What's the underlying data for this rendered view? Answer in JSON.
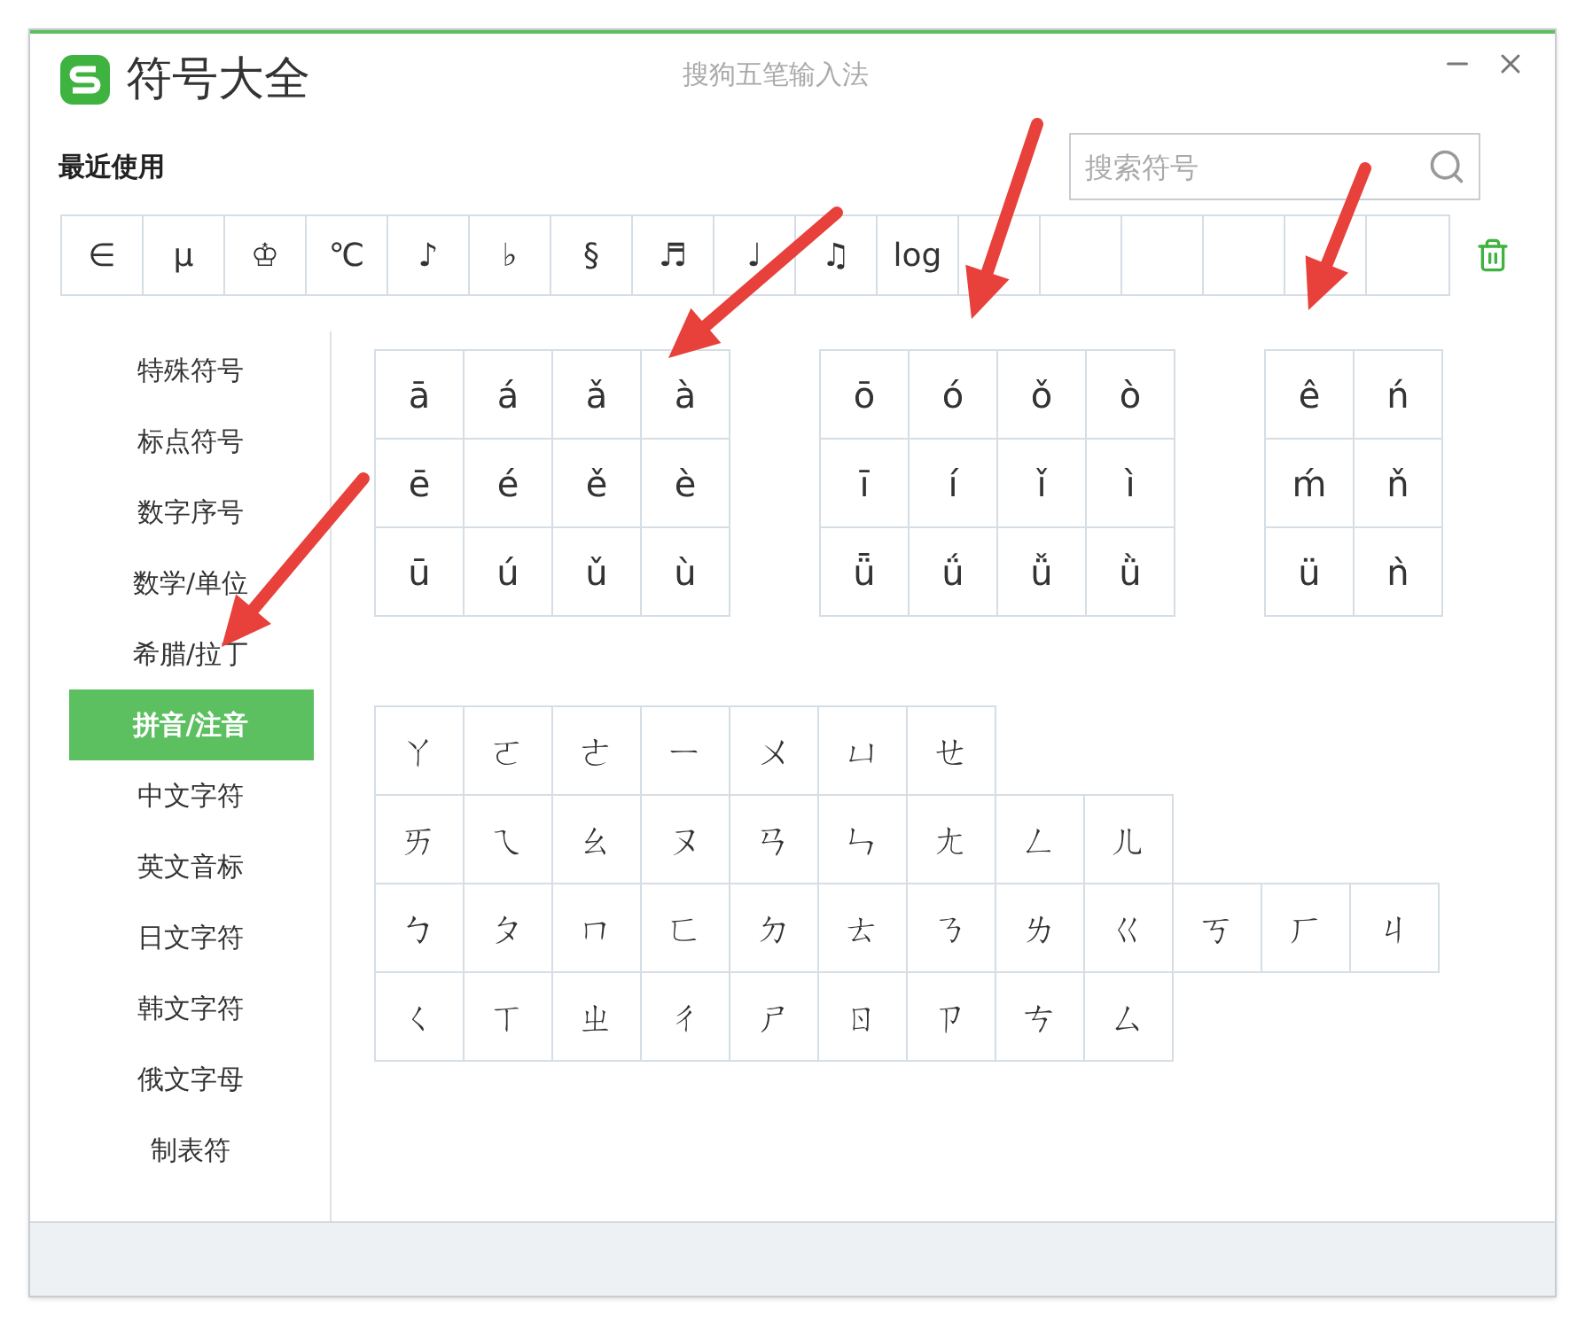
{
  "window": {
    "title": "符号大全",
    "subtitle": "搜狗五笔输入法"
  },
  "recent": {
    "label": "最近使用",
    "symbols": [
      "∈",
      "μ",
      "♔",
      "℃",
      "♪",
      "♭",
      "§",
      "♬",
      "♩",
      "♫",
      "log"
    ]
  },
  "search": {
    "placeholder": "搜索符号"
  },
  "sidebar": {
    "items": [
      {
        "label": "特殊符号",
        "selected": false
      },
      {
        "label": "标点符号",
        "selected": false
      },
      {
        "label": "数字序号",
        "selected": false
      },
      {
        "label": "数学/单位",
        "selected": false
      },
      {
        "label": "希腊/拉丁",
        "selected": false
      },
      {
        "label": "拼音/注音",
        "selected": true
      },
      {
        "label": "中文字符",
        "selected": false
      },
      {
        "label": "英文音标",
        "selected": false
      },
      {
        "label": "日文字符",
        "selected": false
      },
      {
        "label": "韩文字符",
        "selected": false
      },
      {
        "label": "俄文字母",
        "selected": false
      },
      {
        "label": "制表符",
        "selected": false
      }
    ]
  },
  "pinyin_groups": [
    [
      [
        "ā",
        "á",
        "ǎ",
        "à"
      ],
      [
        "ē",
        "é",
        "ě",
        "è"
      ],
      [
        "ū",
        "ú",
        "ǔ",
        "ù"
      ]
    ],
    [
      [
        "ō",
        "ó",
        "ǒ",
        "ò"
      ],
      [
        "ī",
        "í",
        "ǐ",
        "ì"
      ],
      [
        "ǖ",
        "ǘ",
        "ǚ",
        "ǜ"
      ]
    ],
    [
      [
        "ê",
        "ń"
      ],
      [
        "ḿ",
        "ň"
      ],
      [
        "ü",
        "ǹ"
      ]
    ]
  ],
  "zhuyin_rows": [
    [
      "ㄚ",
      "ㄛ",
      "ㄜ",
      "ㄧ",
      "ㄨ",
      "ㄩ",
      "ㄝ"
    ],
    [
      "ㄞ",
      "ㄟ",
      "ㄠ",
      "ㄡ",
      "ㄢ",
      "ㄣ",
      "ㄤ",
      "ㄥ",
      "ㄦ"
    ],
    [
      "ㄅ",
      "ㄆ",
      "ㄇ",
      "ㄈ",
      "ㄉ",
      "ㄊ",
      "ㄋ",
      "ㄌ",
      "ㄍ",
      "ㄎ",
      "ㄏ",
      "ㄐ"
    ],
    [
      "ㄑ",
      "ㄒ",
      "ㄓ",
      "ㄔ",
      "ㄕ",
      "ㄖ",
      "ㄗ",
      "ㄘ",
      "ㄙ"
    ]
  ]
}
